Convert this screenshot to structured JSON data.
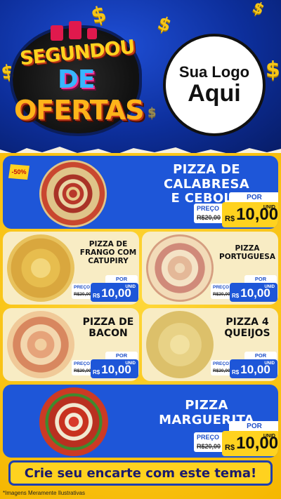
{
  "header": {
    "title_line1": "SEGUNDOU",
    "title_line2": "DE",
    "title_line3": "OFERTAS",
    "logo_line1": "Sua Logo",
    "logo_line2": "Aqui"
  },
  "colors": {
    "header_blue": "#0d2f9c",
    "card_blue": "#1e56d8",
    "yellow": "#ffd21f",
    "cream": "#f8ecc4"
  },
  "offers": [
    {
      "name_line1": "PIZZA DE CALABRESA",
      "name_line2": "E CEBOLA",
      "badge": "-50%",
      "por": "POR",
      "preco_label": "PREÇO",
      "old_price": "R$20,00",
      "currency": "R$",
      "price": "10,00",
      "unit": "UNID"
    },
    {
      "name_line1": "PIZZA DE",
      "name_line2": "FRANGO COM",
      "name_line3": "CATUPIRY",
      "por": "POR",
      "preco_label": "PREÇO",
      "old_price": "R$20,00",
      "currency": "R$",
      "price": "10,00",
      "unit": "UNID"
    },
    {
      "name_line1": "PIZZA",
      "name_line2": "PORTUGUESA",
      "por": "POR",
      "preco_label": "PREÇO",
      "old_price": "R$20,00",
      "currency": "R$",
      "price": "10,00",
      "unit": "UNID"
    },
    {
      "name_line1": "PIZZA DE",
      "name_line2": "BACON",
      "por": "POR",
      "preco_label": "PREÇO",
      "old_price": "R$20,00",
      "currency": "R$",
      "price": "10,00",
      "unit": "UNID"
    },
    {
      "name_line1": "PIZZA 4",
      "name_line2": "QUEIJOS",
      "por": "POR",
      "preco_label": "PREÇO",
      "old_price": "R$20,00",
      "currency": "R$",
      "price": "10,00",
      "unit": "UNID"
    },
    {
      "name_line1": "PIZZA MARGUERITA",
      "por": "POR",
      "preco_label": "PREÇO",
      "old_price": "R$20,00",
      "currency": "R$",
      "price": "10,00",
      "unit": "UNID"
    }
  ],
  "cta": "Crie seu encarte com este tema!",
  "footnote": "*Imagens Meramente Ilustrativas",
  "icons": [
    "dollar-sign-icon",
    "gift-box-icon",
    "percent-badge-icon"
  ]
}
